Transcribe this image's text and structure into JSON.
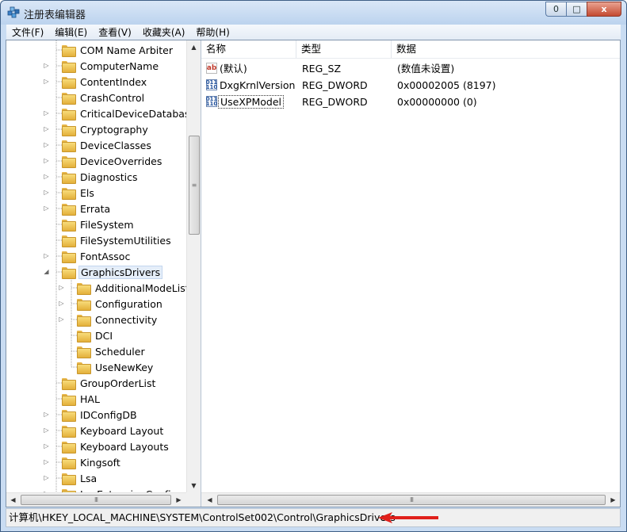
{
  "window": {
    "title": "注册表编辑器",
    "controls": [
      "0",
      "□",
      "x"
    ]
  },
  "menu": [
    "文件(F)",
    "编辑(E)",
    "查看(V)",
    "收藏夹(A)",
    "帮助(H)"
  ],
  "tree": {
    "items": [
      {
        "label": "COM Name Arbiter",
        "expandable": false
      },
      {
        "label": "ComputerName",
        "expandable": true
      },
      {
        "label": "ContentIndex",
        "expandable": true
      },
      {
        "label": "CrashControl",
        "expandable": false
      },
      {
        "label": "CriticalDeviceDatabase",
        "expandable": true
      },
      {
        "label": "Cryptography",
        "expandable": true
      },
      {
        "label": "DeviceClasses",
        "expandable": true
      },
      {
        "label": "DeviceOverrides",
        "expandable": true
      },
      {
        "label": "Diagnostics",
        "expandable": true
      },
      {
        "label": "Els",
        "expandable": true
      },
      {
        "label": "Errata",
        "expandable": true
      },
      {
        "label": "FileSystem",
        "expandable": false
      },
      {
        "label": "FileSystemUtilities",
        "expandable": false
      },
      {
        "label": "FontAssoc",
        "expandable": true
      },
      {
        "label": "GraphicsDrivers",
        "expandable": true,
        "expanded": true,
        "selected": true
      },
      {
        "label": "AdditionalModeLists",
        "expandable": true,
        "child": true
      },
      {
        "label": "Configuration",
        "expandable": true,
        "child": true
      },
      {
        "label": "Connectivity",
        "expandable": true,
        "child": true
      },
      {
        "label": "DCI",
        "expandable": false,
        "child": true
      },
      {
        "label": "Scheduler",
        "expandable": false,
        "child": true
      },
      {
        "label": "UseNewKey",
        "expandable": false,
        "child": true,
        "last": true
      },
      {
        "label": "GroupOrderList",
        "expandable": false
      },
      {
        "label": "HAL",
        "expandable": false
      },
      {
        "label": "IDConfigDB",
        "expandable": true
      },
      {
        "label": "Keyboard Layout",
        "expandable": true
      },
      {
        "label": "Keyboard Layouts",
        "expandable": true
      },
      {
        "label": "Kingsoft",
        "expandable": true
      },
      {
        "label": "Lsa",
        "expandable": true
      },
      {
        "label": "LsaExtensionConfig",
        "expandable": true
      }
    ]
  },
  "values_pane": {
    "columns": [
      "名称",
      "类型",
      "数据"
    ],
    "rows": [
      {
        "icon": "string-value-icon",
        "glyph": "ab",
        "name": "(默认)",
        "type": "REG_SZ",
        "data": "(数值未设置)"
      },
      {
        "icon": "dword-value-icon",
        "glyph": "011\n110",
        "name": "DxgKrnlVersion",
        "type": "REG_DWORD",
        "data": "0x00002005 (8197)"
      },
      {
        "icon": "dword-value-icon",
        "glyph": "011\n110",
        "name": "UseXPModel",
        "type": "REG_DWORD",
        "data": "0x00000000 (0)",
        "focused": true
      }
    ]
  },
  "scroll": {
    "up": "▲",
    "down": "▼",
    "left": "◀",
    "right": "▶",
    "grip": "≡",
    "hgrip": "III"
  },
  "status": {
    "path": "计算机\\HKEY_LOCAL_MACHINE\\SYSTEM\\ControlSet002\\Control\\GraphicsDrivers"
  },
  "colors": {
    "annotation_arrow": "#e0201b",
    "selection": "#e5eef9"
  }
}
